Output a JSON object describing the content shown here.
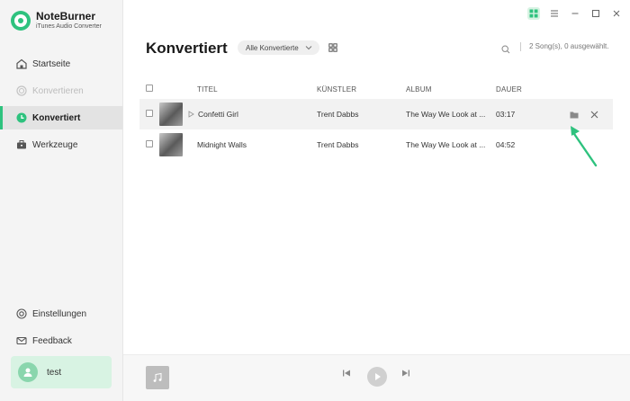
{
  "brand": {
    "name": "NoteBurner",
    "subtitle": "iTunes Audio Converter"
  },
  "nav": {
    "items": [
      {
        "label": "Startseite",
        "icon": "home-icon",
        "state": "normal"
      },
      {
        "label": "Konvertieren",
        "icon": "convert-icon",
        "state": "disabled"
      },
      {
        "label": "Konvertiert",
        "icon": "clock-icon",
        "state": "active"
      },
      {
        "label": "Werkzeuge",
        "icon": "toolbox-icon",
        "state": "normal"
      }
    ],
    "bottom": [
      {
        "label": "Einstellungen",
        "icon": "settings-icon"
      },
      {
        "label": "Feedback",
        "icon": "mail-icon"
      }
    ]
  },
  "user": {
    "name": "test"
  },
  "header": {
    "title": "Konvertiert",
    "filter_label": "Alle Konvertierte",
    "count_text": "2 Song(s), 0 ausgewählt."
  },
  "table": {
    "columns": [
      "TITEL",
      "KÜNSTLER",
      "ALBUM",
      "DAUER"
    ],
    "rows": [
      {
        "title": "Confetti Girl",
        "artist": "Trent Dabbs",
        "album": "The Way We Look at ...",
        "duration": "03:17"
      },
      {
        "title": "Midnight Walls",
        "artist": "Trent Dabbs",
        "album": "The Way We Look at ...",
        "duration": "04:52"
      }
    ]
  },
  "colors": {
    "accent": "#2ec27e",
    "active_bg": "#e3e3e3",
    "user_card": "#d8f3e3"
  }
}
